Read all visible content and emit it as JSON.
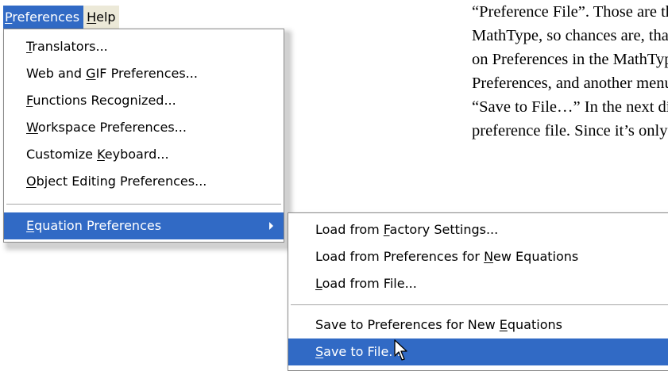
{
  "document": {
    "lines": [
      "“Preference File”. Those are th",
      "MathType, so chances are, that",
      "on Preferences in the MathTyp",
      "Preferences, and another menu",
      "“Save to File…” In the next di",
      "preference file. Since it’s only"
    ]
  },
  "menubar": {
    "items": [
      {
        "pre": "",
        "u": "P",
        "post": "references"
      },
      {
        "pre": "",
        "u": "H",
        "post": "elp"
      }
    ]
  },
  "preferences_menu": {
    "items": [
      {
        "pre": "",
        "u": "T",
        "post": "ranslators..."
      },
      {
        "pre": "Web and ",
        "u": "G",
        "post": "IF Preferences..."
      },
      {
        "pre": "",
        "u": "F",
        "post": "unctions Recognized..."
      },
      {
        "pre": "",
        "u": "W",
        "post": "orkspace Preferences..."
      },
      {
        "pre": "Customize ",
        "u": "K",
        "post": "eyboard..."
      },
      {
        "pre": "",
        "u": "O",
        "post": "bject Editing Preferences..."
      }
    ],
    "equation_item": {
      "pre": "",
      "u": "E",
      "post": "quation Preferences"
    }
  },
  "equation_submenu": {
    "group1": [
      {
        "pre": "Load from ",
        "u": "F",
        "post": "actory Settings..."
      },
      {
        "pre": "Load from Preferences for ",
        "u": "N",
        "post": "ew Equations"
      },
      {
        "pre": "",
        "u": "L",
        "post": "oad from File..."
      }
    ],
    "group2": [
      {
        "pre": "Save to Preferences for New ",
        "u": "E",
        "post": "quations"
      },
      {
        "pre": "",
        "u": "S",
        "post": "ave to File..."
      }
    ]
  },
  "colors": {
    "highlight": "#316ac5",
    "menubar_bg": "#ece9d8"
  }
}
